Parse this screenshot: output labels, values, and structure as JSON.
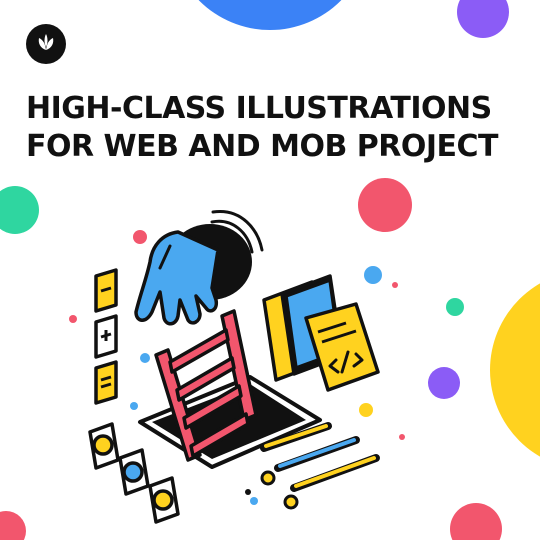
{
  "headline": {
    "line1": "HIGH-CLASS ILLUSTRATIONS",
    "line2": "FOR WEB AND MOB PROJECT"
  },
  "icons": {
    "logo": "sprout-icon",
    "minus_key": "minus-icon",
    "plus_key": "plus-icon",
    "equals_key": "equals-icon",
    "code_doc": "code-icon"
  },
  "colors": {
    "blue": "#3b82f6",
    "purple": "#8b5cf6",
    "coral": "#f2566d",
    "teal": "#2fd6a0",
    "yellow": "#ffd21f",
    "sky": "#4aa8f0",
    "ink": "#111111"
  }
}
